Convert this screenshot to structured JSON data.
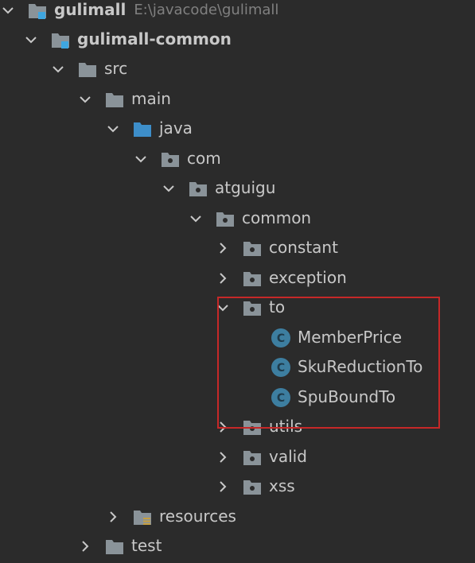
{
  "colors": {
    "background": "#2b2b2b",
    "text": "#c8c8c8",
    "path_text": "#808080",
    "folder": "#8a9399",
    "module_badge": "#3fa6e0",
    "source_folder": "#3d8ec9",
    "class_icon": "#3d7ea0",
    "highlight_border": "#c62828"
  },
  "tree": {
    "project": {
      "label": "gulimall",
      "path": "E:\\javacode\\gulimall",
      "icon": "module-folder-icon"
    },
    "items": [
      {
        "label": "gulimall-common",
        "icon": "module-folder-icon",
        "expanded": true
      },
      {
        "label": "src",
        "icon": "folder-icon",
        "expanded": true
      },
      {
        "label": "main",
        "icon": "folder-icon",
        "expanded": true
      },
      {
        "label": "java",
        "icon": "source-folder-icon",
        "expanded": true
      },
      {
        "label": "com",
        "icon": "package-icon",
        "expanded": true
      },
      {
        "label": "atguigu",
        "icon": "package-icon",
        "expanded": true
      },
      {
        "label": "common",
        "icon": "package-icon",
        "expanded": true
      },
      {
        "label": "constant",
        "icon": "package-icon",
        "expanded": false
      },
      {
        "label": "exception",
        "icon": "package-icon",
        "expanded": false
      },
      {
        "label": "to",
        "icon": "package-icon",
        "expanded": true
      },
      {
        "label": "MemberPrice",
        "icon": "class-icon",
        "icon_letter": "C"
      },
      {
        "label": "SkuReductionTo",
        "icon": "class-icon",
        "icon_letter": "C"
      },
      {
        "label": "SpuBoundTo",
        "icon": "class-icon",
        "icon_letter": "C"
      },
      {
        "label": "utils",
        "icon": "package-icon",
        "expanded": false
      },
      {
        "label": "valid",
        "icon": "package-icon",
        "expanded": false
      },
      {
        "label": "xss",
        "icon": "package-icon",
        "expanded": false
      },
      {
        "label": "resources",
        "icon": "resources-folder-icon",
        "expanded": false
      },
      {
        "label": "test",
        "icon": "folder-icon",
        "expanded": false
      }
    ]
  }
}
